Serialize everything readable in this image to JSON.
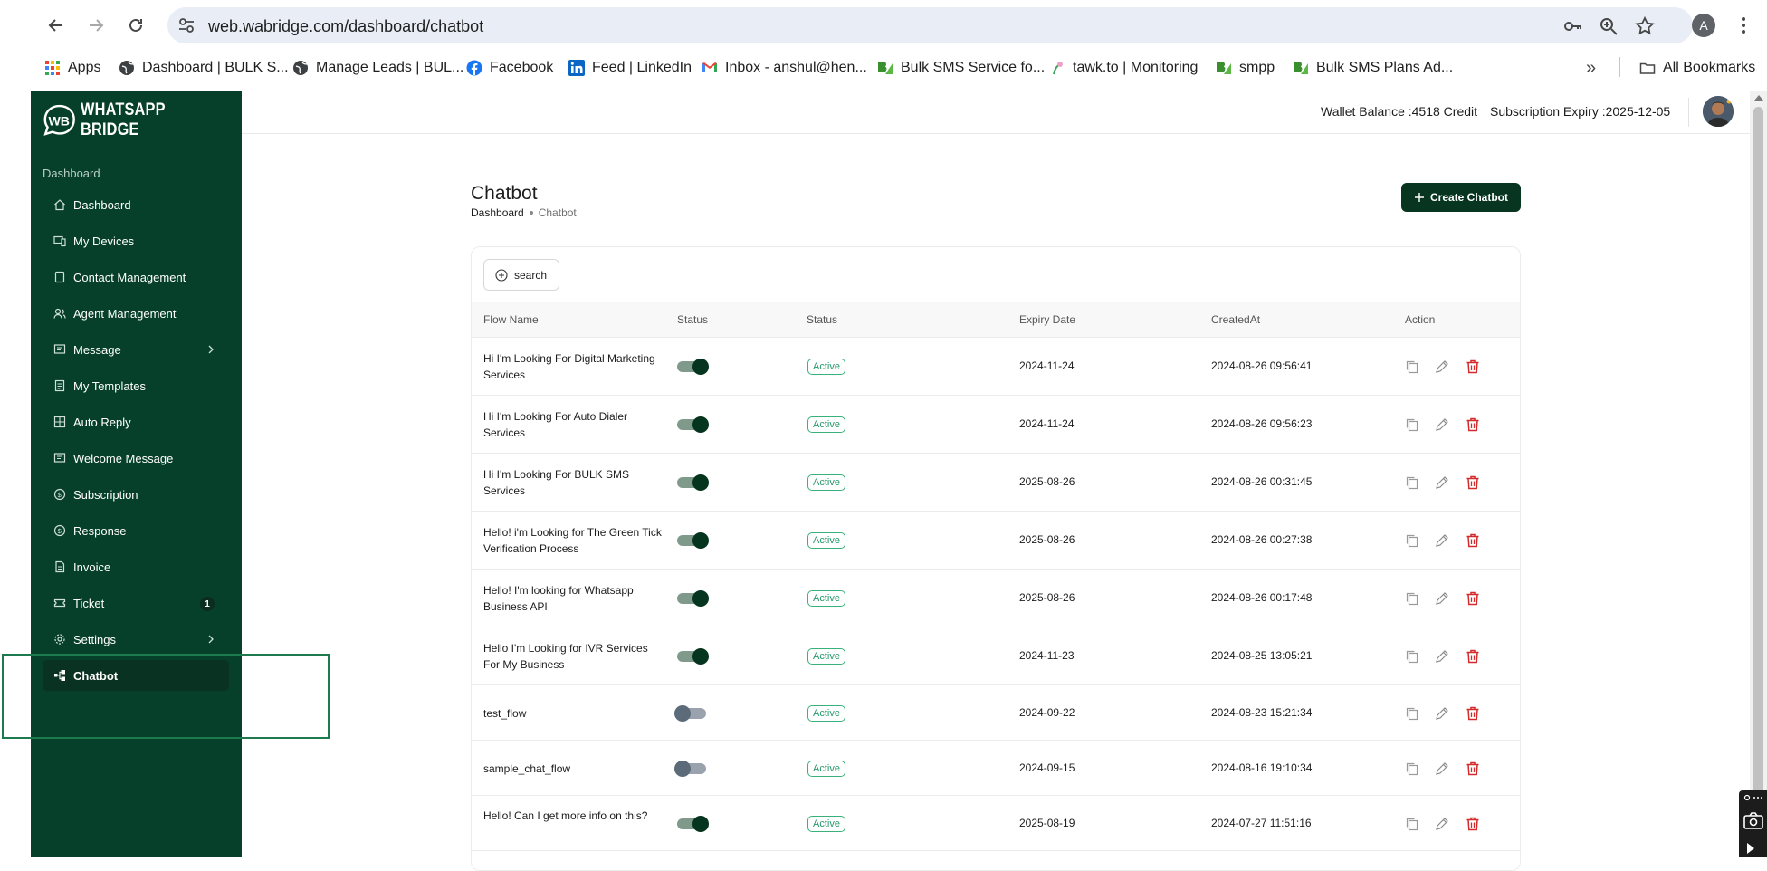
{
  "browser": {
    "url": "web.wabridge.com/dashboard/chatbot",
    "profile_initial": "A",
    "bookmarks": [
      {
        "label": "Apps",
        "icon": "apps-grid-icon"
      },
      {
        "label": "Dashboard | BULK S...",
        "icon": "globe-icon"
      },
      {
        "label": "Manage Leads | BUL...",
        "icon": "globe-icon"
      },
      {
        "label": "Facebook",
        "icon": "facebook-icon"
      },
      {
        "label": "Feed | LinkedIn",
        "icon": "linkedin-icon"
      },
      {
        "label": "Inbox - anshul@hen...",
        "icon": "gmail-icon"
      },
      {
        "label": "Bulk SMS Service fo...",
        "icon": "bulk-sms-icon"
      },
      {
        "label": "tawk.to | Monitoring",
        "icon": "tawkto-icon"
      },
      {
        "label": "smpp",
        "icon": "bulk-sms-icon"
      },
      {
        "label": "Bulk SMS Plans Ad...",
        "icon": "bulk-sms-icon"
      }
    ],
    "all_bookmarks": "All Bookmarks"
  },
  "brand": {
    "name": "WHATSAPP BRIDGE"
  },
  "sidebar": {
    "section": "Dashboard",
    "items": [
      {
        "label": "Dashboard",
        "icon": "home-icon"
      },
      {
        "label": "My Devices",
        "icon": "devices-icon"
      },
      {
        "label": "Contact Management",
        "icon": "contact-icon"
      },
      {
        "label": "Agent Management",
        "icon": "agent-icon"
      },
      {
        "label": "Message",
        "icon": "message-icon",
        "expandable": true
      },
      {
        "label": "My Templates",
        "icon": "template-icon"
      },
      {
        "label": "Auto Reply",
        "icon": "auto-reply-icon"
      },
      {
        "label": "Welcome Message",
        "icon": "welcome-icon"
      },
      {
        "label": "Subscription",
        "icon": "subscription-icon"
      },
      {
        "label": "Response",
        "icon": "response-icon"
      },
      {
        "label": "Invoice",
        "icon": "invoice-icon"
      },
      {
        "label": "Ticket",
        "icon": "ticket-icon",
        "badge": "1"
      },
      {
        "label": "Settings",
        "icon": "settings-icon",
        "expandable": true
      },
      {
        "label": "Chatbot",
        "icon": "chatbot-icon",
        "active": true
      }
    ]
  },
  "topbar": {
    "wallet": "Wallet Balance :4518 Credit",
    "expiry": "Subscription Expiry :2025-12-05"
  },
  "page": {
    "title": "Chatbot",
    "breadcrumb_root": "Dashboard",
    "breadcrumb_current": "Chatbot",
    "create_label": "Create Chatbot",
    "search_label": "search"
  },
  "table": {
    "headers": [
      "Flow Name",
      "Status",
      "Status",
      "Expiry Date",
      "CreatedAt",
      "Action"
    ],
    "rows": [
      {
        "flow": "Hi I'm Looking For Digital Marketing Services",
        "enabled": true,
        "status": "Active",
        "expiry": "2024-11-24",
        "created": "2024-08-26 09:56:41"
      },
      {
        "flow": "Hi I'm Looking For Auto Dialer Services",
        "enabled": true,
        "status": "Active",
        "expiry": "2024-11-24",
        "created": "2024-08-26 09:56:23"
      },
      {
        "flow": "Hi I'm Looking For BULK SMS Services",
        "enabled": true,
        "status": "Active",
        "expiry": "2025-08-26",
        "created": "2024-08-26 00:31:45"
      },
      {
        "flow": "Hello! i'm Looking for The Green Tick Verification Process",
        "enabled": true,
        "status": "Active",
        "expiry": "2025-08-26",
        "created": "2024-08-26 00:27:38"
      },
      {
        "flow": "Hello! I'm looking for Whatsapp Business API",
        "enabled": true,
        "status": "Active",
        "expiry": "2025-08-26",
        "created": "2024-08-26 00:17:48"
      },
      {
        "flow": "Hello I'm Looking for IVR Services For My Business",
        "enabled": true,
        "status": "Active",
        "expiry": "2024-11-23",
        "created": "2024-08-25 13:05:21"
      },
      {
        "flow": "test_flow",
        "enabled": false,
        "status": "Active",
        "expiry": "2024-09-22",
        "created": "2024-08-23 15:21:34"
      },
      {
        "flow": "sample_chat_flow",
        "enabled": false,
        "status": "Active",
        "expiry": "2024-09-15",
        "created": "2024-08-16 19:10:34"
      },
      {
        "flow": "Hello! Can I get more info on this?",
        "enabled": true,
        "status": "Active",
        "expiry": "2025-08-19",
        "created": "2024-07-27 11:51:16"
      }
    ]
  },
  "colors": {
    "sidebar_bg": "#063f2a",
    "primary": "#07351f",
    "active_green": "#24986a",
    "delete_red": "#d12b2b"
  }
}
